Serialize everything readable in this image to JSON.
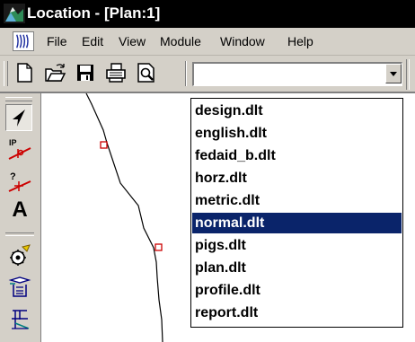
{
  "window": {
    "title": "Location - [Plan:1]"
  },
  "menu": {
    "items": [
      "File",
      "Edit",
      "View",
      "Module",
      "Window",
      "Help"
    ]
  },
  "toolbar": {
    "buttons": [
      "new-file-icon",
      "open-folder-icon",
      "save-disk-icon",
      "print-icon",
      "print-preview-icon"
    ],
    "combo_value": ""
  },
  "palette": {
    "tools": [
      "select-arrow-icon",
      "pi-point-icon",
      "query-icon",
      "text-tool-icon",
      "settings-wrench-icon",
      "layers-icon",
      "network-icon"
    ],
    "text_tool_label": "A"
  },
  "dropdown": {
    "items": [
      "design.dlt",
      "english.dlt",
      "fedaid_b.dlt",
      "horz.dlt",
      "metric.dlt",
      "normal.dlt",
      "pigs.dlt",
      "plan.dlt",
      "profile.dlt",
      "report.dlt"
    ],
    "selected_index": 5
  },
  "colors": {
    "selection": "#0a246a",
    "chrome": "#d4d0c8",
    "titlebar": "#000000",
    "alignment_point": "#cc0000"
  }
}
